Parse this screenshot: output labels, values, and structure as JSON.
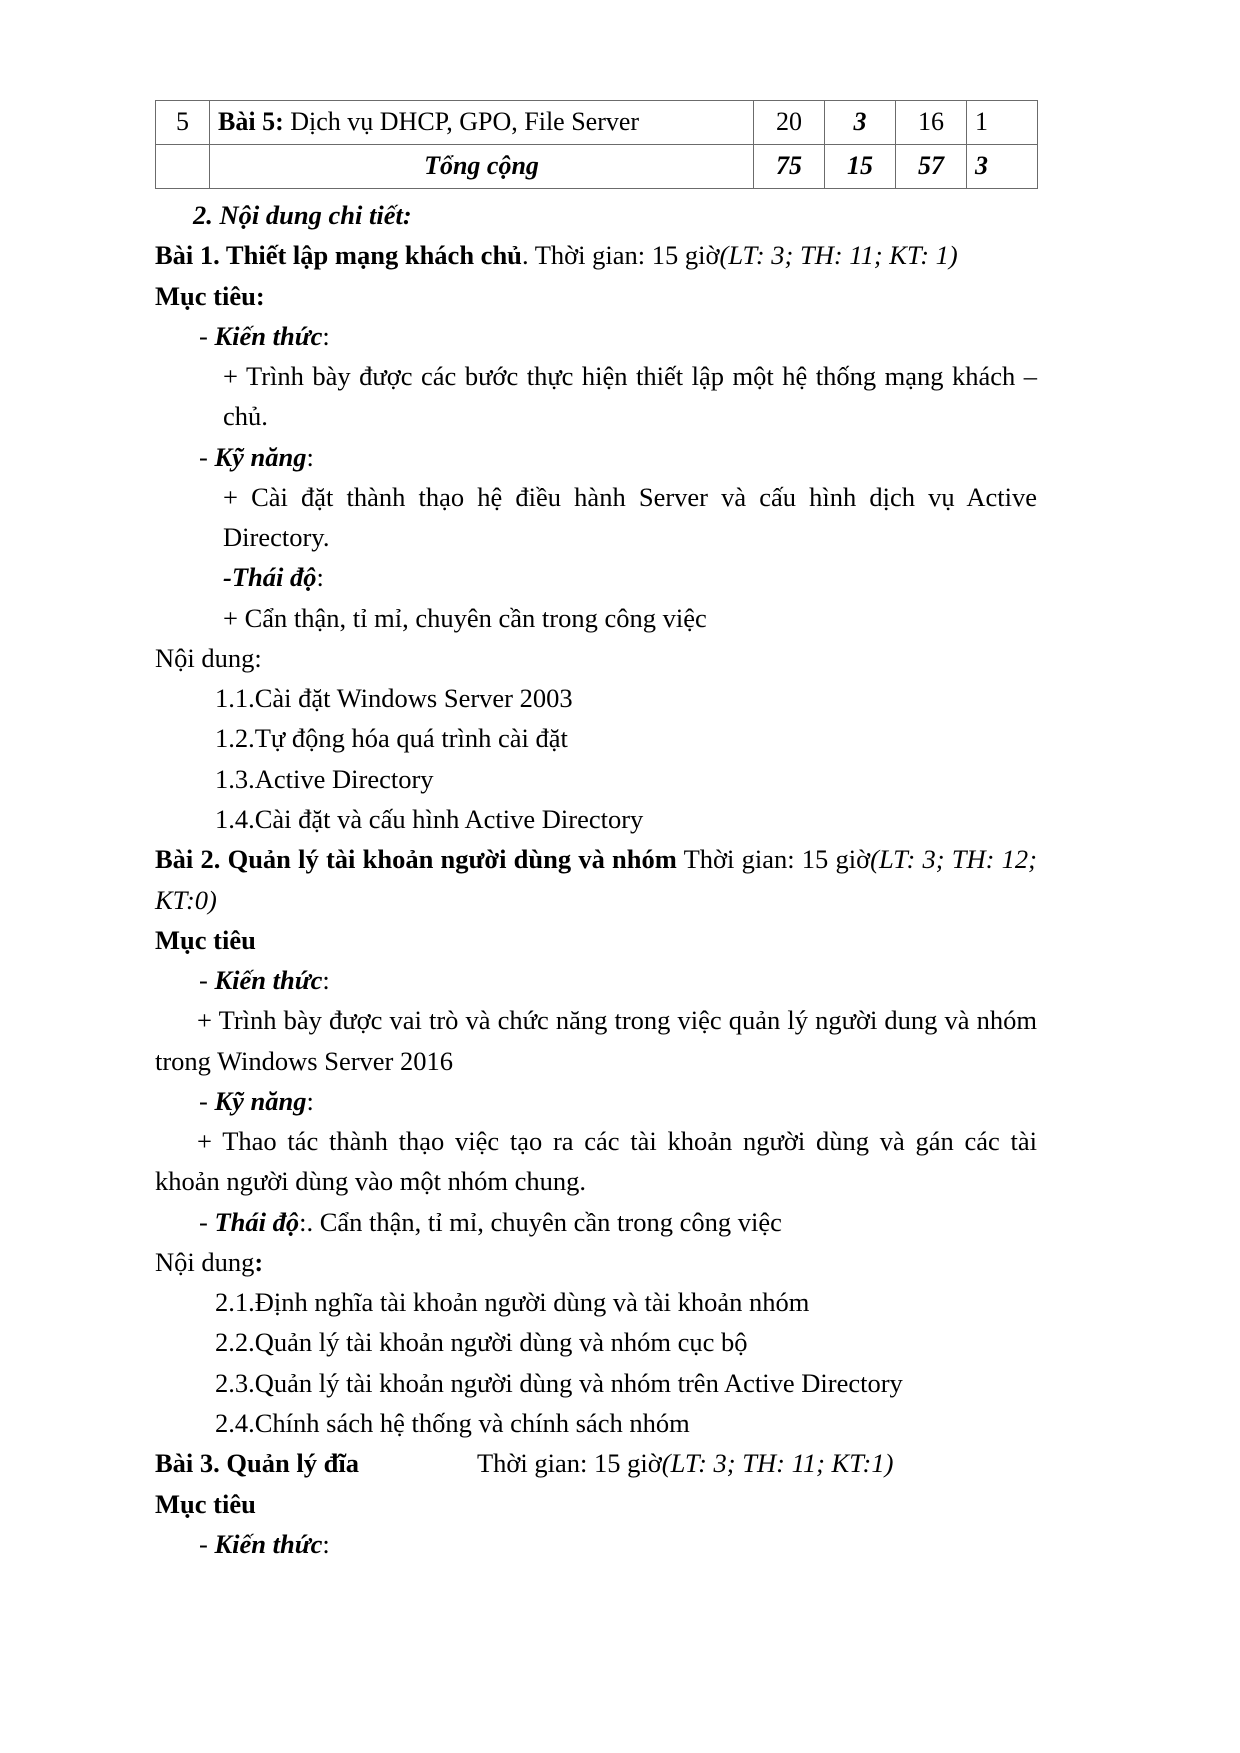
{
  "document": {
    "table": {
      "rows": [
        {
          "index": "5",
          "title_bold": "Bài 5:",
          "title_rest": " Dịch vụ DHCP, GPO, File Server",
          "total": "20",
          "lt": "3",
          "th": "16",
          "kt": "1"
        },
        {
          "index": "",
          "title_bold": "Tổng cộng",
          "title_rest": "",
          "total": "75",
          "lt": "15",
          "th": "57",
          "kt": "3"
        }
      ]
    },
    "section_heading": "2. Nội dung chi tiết:",
    "lessons": [
      {
        "heading_bold": "Bài 1. Thiết lập mạng khách chủ",
        "heading_plain": ". Thời gian: 15 giờ",
        "heading_italic": "(LT: 3; TH: 11; KT: 1)",
        "objective_label": "Mục tiêu:",
        "knowledge_dash": "- ",
        "knowledge_label": "Kiến thức",
        "knowledge_colon": ":",
        "knowledge_body": "+ Trình bày được các bước thực hiện thiết lập một hệ thống mạng khách – chủ.",
        "skill_dash": "- ",
        "skill_label": "Kỹ năng",
        "skill_colon": ":",
        "skill_body": "+ Cài đặt thành thạo hệ điều hành Server và cấu hình dịch vụ Active Directory.",
        "attitude_dash": "-",
        "attitude_label": "Thái độ",
        "attitude_colon": ":",
        "attitude_body": "+ Cẩn thận, tỉ mỉ, chuyên cần trong công việc",
        "content_label": "Nội dung:",
        "content_items": [
          "1.1.Cài đặt Windows Server 2003",
          "1.2.Tự động hóa quá trình cài đặt",
          "1.3.Active Directory",
          "1.4.Cài đặt và cấu hình Active Directory"
        ]
      },
      {
        "heading_bold": "Bài 2. Quản lý tài khoản người dùng và nhóm",
        "heading_plain": " Thời gian: 15 giờ",
        "heading_italic": "(LT: 3; TH: 12; KT:0)",
        "objective_label": "Mục tiêu",
        "knowledge_dash": "- ",
        "knowledge_label": "Kiến thức",
        "knowledge_colon": ":",
        "knowledge_body": "+ Trình bày được vai trò và chức năng trong việc quản lý người dung và nhóm trong Windows Server 2016",
        "skill_dash": "- ",
        "skill_label": "Kỹ năng",
        "skill_colon": ":",
        "skill_body": "+ Thao tác thành thạo việc tạo ra các tài khoản người dùng và gán các tài khoản người dùng vào một nhóm chung.",
        "attitude_dash": "- ",
        "attitude_label": "Thái độ",
        "attitude_colon": ":. Cẩn thận, tỉ mỉ, chuyên cần trong công việc",
        "content_label": "Nội dung",
        "content_label_colon": ":",
        "content_items": [
          "2.1.Định nghĩa tài khoản người dùng và tài khoản nhóm",
          "2.2.Quản lý tài khoản người dùng và nhóm cục bộ",
          "2.3.Quản lý tài khoản người dùng và nhóm trên Active Directory",
          "2.4.Chính sách hệ thống và chính sách nhóm"
        ]
      },
      {
        "heading_bold": "Bài 3. Quản lý đĩa",
        "heading_plain": "Thời gian: 15 giờ",
        "heading_italic": "(LT: 3; TH: 11; KT:1)",
        "objective_label": "Mục tiêu",
        "knowledge_dash": "- ",
        "knowledge_label": "Kiến thức",
        "knowledge_colon": ":"
      }
    ]
  }
}
